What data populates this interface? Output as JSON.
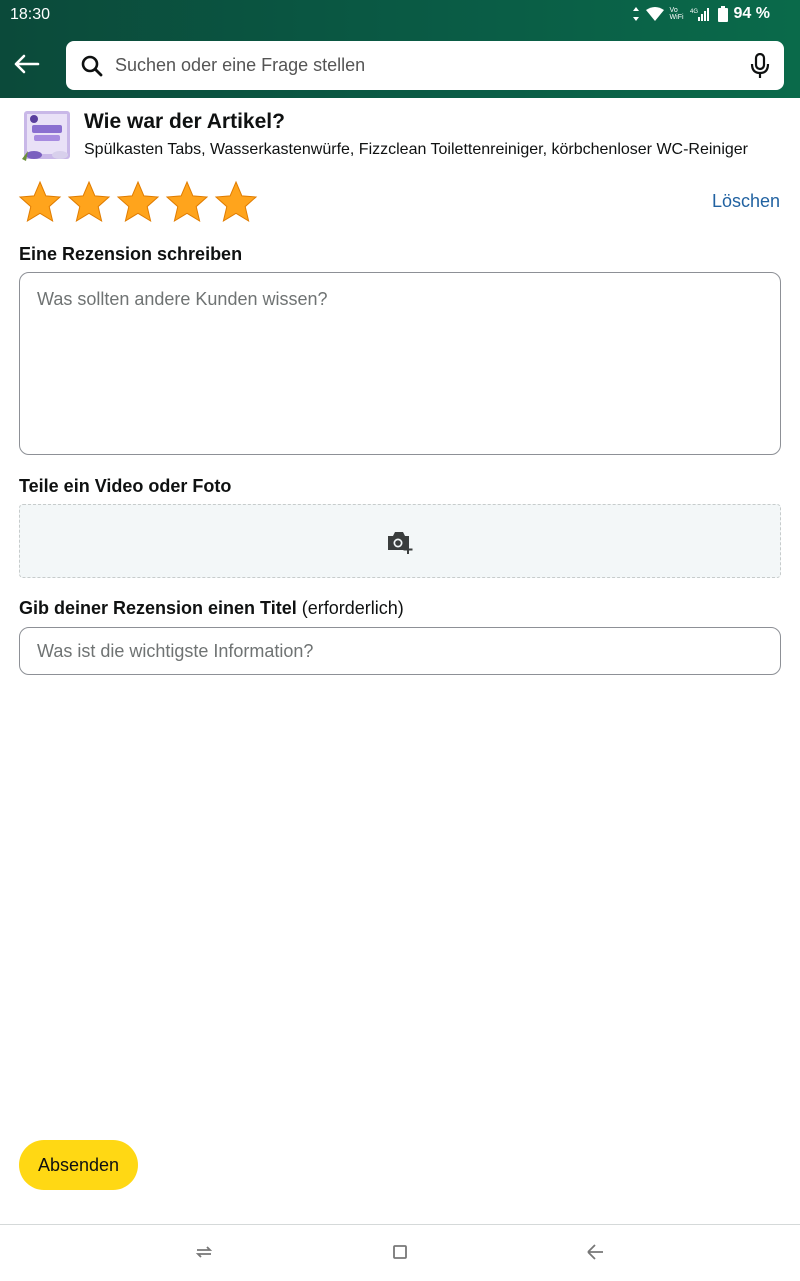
{
  "status_bar": {
    "time": "18:30",
    "battery": "94 %",
    "icons": [
      "data-arrows-icon",
      "wifi-icon",
      "vowifi-icon",
      "4g-signal-icon",
      "battery-icon"
    ]
  },
  "header": {
    "search_placeholder": "Suchen oder eine Frage stellen",
    "icons": [
      "back-arrow-icon",
      "search-icon",
      "microphone-icon"
    ]
  },
  "product": {
    "question": "Wie war der Artikel?",
    "name": "Spülkasten Tabs, Wasserkastenwürfe, Fizzclean Toilettenreiniger, körbchenloser WC-Reiniger"
  },
  "rating": {
    "stars": 5,
    "max": 5,
    "clear_label": "Löschen",
    "star_color": "#ffa41c"
  },
  "review": {
    "label": "Eine Rezension schreiben",
    "placeholder": "Was sollten andere Kunden wissen?"
  },
  "media": {
    "label": "Teile ein Video oder Foto",
    "icon": "camera-add-icon"
  },
  "title_field": {
    "label": "Gib deiner Rezension einen Titel",
    "required": "(erforderlich)",
    "placeholder": "Was ist die wichtigste Information?"
  },
  "submit_label": "Absenden",
  "nav": [
    "recent-apps-icon",
    "home-icon",
    "back-icon"
  ]
}
